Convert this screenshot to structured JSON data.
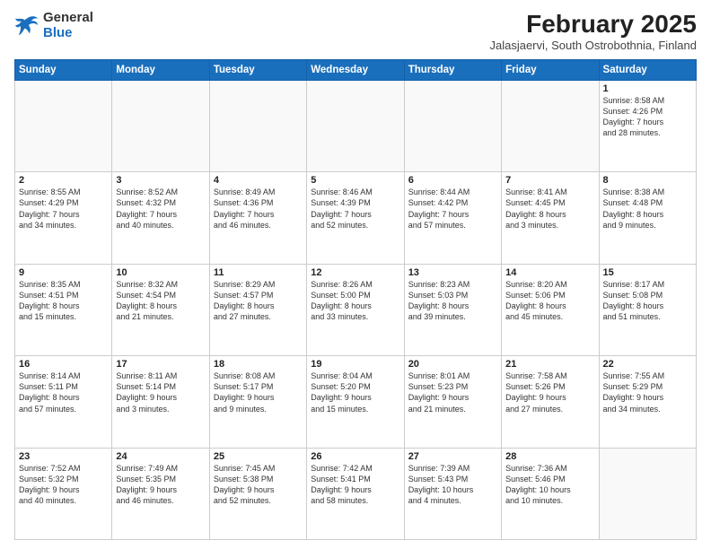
{
  "header": {
    "logo_general": "General",
    "logo_blue": "Blue",
    "month_year": "February 2025",
    "location": "Jalasjaervi, South Ostrobothnia, Finland"
  },
  "days_of_week": [
    "Sunday",
    "Monday",
    "Tuesday",
    "Wednesday",
    "Thursday",
    "Friday",
    "Saturday"
  ],
  "weeks": [
    [
      {
        "day": "",
        "text": ""
      },
      {
        "day": "",
        "text": ""
      },
      {
        "day": "",
        "text": ""
      },
      {
        "day": "",
        "text": ""
      },
      {
        "day": "",
        "text": ""
      },
      {
        "day": "",
        "text": ""
      },
      {
        "day": "1",
        "text": "Sunrise: 8:58 AM\nSunset: 4:26 PM\nDaylight: 7 hours\nand 28 minutes."
      }
    ],
    [
      {
        "day": "2",
        "text": "Sunrise: 8:55 AM\nSunset: 4:29 PM\nDaylight: 7 hours\nand 34 minutes."
      },
      {
        "day": "3",
        "text": "Sunrise: 8:52 AM\nSunset: 4:32 PM\nDaylight: 7 hours\nand 40 minutes."
      },
      {
        "day": "4",
        "text": "Sunrise: 8:49 AM\nSunset: 4:36 PM\nDaylight: 7 hours\nand 46 minutes."
      },
      {
        "day": "5",
        "text": "Sunrise: 8:46 AM\nSunset: 4:39 PM\nDaylight: 7 hours\nand 52 minutes."
      },
      {
        "day": "6",
        "text": "Sunrise: 8:44 AM\nSunset: 4:42 PM\nDaylight: 7 hours\nand 57 minutes."
      },
      {
        "day": "7",
        "text": "Sunrise: 8:41 AM\nSunset: 4:45 PM\nDaylight: 8 hours\nand 3 minutes."
      },
      {
        "day": "8",
        "text": "Sunrise: 8:38 AM\nSunset: 4:48 PM\nDaylight: 8 hours\nand 9 minutes."
      }
    ],
    [
      {
        "day": "9",
        "text": "Sunrise: 8:35 AM\nSunset: 4:51 PM\nDaylight: 8 hours\nand 15 minutes."
      },
      {
        "day": "10",
        "text": "Sunrise: 8:32 AM\nSunset: 4:54 PM\nDaylight: 8 hours\nand 21 minutes."
      },
      {
        "day": "11",
        "text": "Sunrise: 8:29 AM\nSunset: 4:57 PM\nDaylight: 8 hours\nand 27 minutes."
      },
      {
        "day": "12",
        "text": "Sunrise: 8:26 AM\nSunset: 5:00 PM\nDaylight: 8 hours\nand 33 minutes."
      },
      {
        "day": "13",
        "text": "Sunrise: 8:23 AM\nSunset: 5:03 PM\nDaylight: 8 hours\nand 39 minutes."
      },
      {
        "day": "14",
        "text": "Sunrise: 8:20 AM\nSunset: 5:06 PM\nDaylight: 8 hours\nand 45 minutes."
      },
      {
        "day": "15",
        "text": "Sunrise: 8:17 AM\nSunset: 5:08 PM\nDaylight: 8 hours\nand 51 minutes."
      }
    ],
    [
      {
        "day": "16",
        "text": "Sunrise: 8:14 AM\nSunset: 5:11 PM\nDaylight: 8 hours\nand 57 minutes."
      },
      {
        "day": "17",
        "text": "Sunrise: 8:11 AM\nSunset: 5:14 PM\nDaylight: 9 hours\nand 3 minutes."
      },
      {
        "day": "18",
        "text": "Sunrise: 8:08 AM\nSunset: 5:17 PM\nDaylight: 9 hours\nand 9 minutes."
      },
      {
        "day": "19",
        "text": "Sunrise: 8:04 AM\nSunset: 5:20 PM\nDaylight: 9 hours\nand 15 minutes."
      },
      {
        "day": "20",
        "text": "Sunrise: 8:01 AM\nSunset: 5:23 PM\nDaylight: 9 hours\nand 21 minutes."
      },
      {
        "day": "21",
        "text": "Sunrise: 7:58 AM\nSunset: 5:26 PM\nDaylight: 9 hours\nand 27 minutes."
      },
      {
        "day": "22",
        "text": "Sunrise: 7:55 AM\nSunset: 5:29 PM\nDaylight: 9 hours\nand 34 minutes."
      }
    ],
    [
      {
        "day": "23",
        "text": "Sunrise: 7:52 AM\nSunset: 5:32 PM\nDaylight: 9 hours\nand 40 minutes."
      },
      {
        "day": "24",
        "text": "Sunrise: 7:49 AM\nSunset: 5:35 PM\nDaylight: 9 hours\nand 46 minutes."
      },
      {
        "day": "25",
        "text": "Sunrise: 7:45 AM\nSunset: 5:38 PM\nDaylight: 9 hours\nand 52 minutes."
      },
      {
        "day": "26",
        "text": "Sunrise: 7:42 AM\nSunset: 5:41 PM\nDaylight: 9 hours\nand 58 minutes."
      },
      {
        "day": "27",
        "text": "Sunrise: 7:39 AM\nSunset: 5:43 PM\nDaylight: 10 hours\nand 4 minutes."
      },
      {
        "day": "28",
        "text": "Sunrise: 7:36 AM\nSunset: 5:46 PM\nDaylight: 10 hours\nand 10 minutes."
      },
      {
        "day": "",
        "text": ""
      }
    ]
  ]
}
